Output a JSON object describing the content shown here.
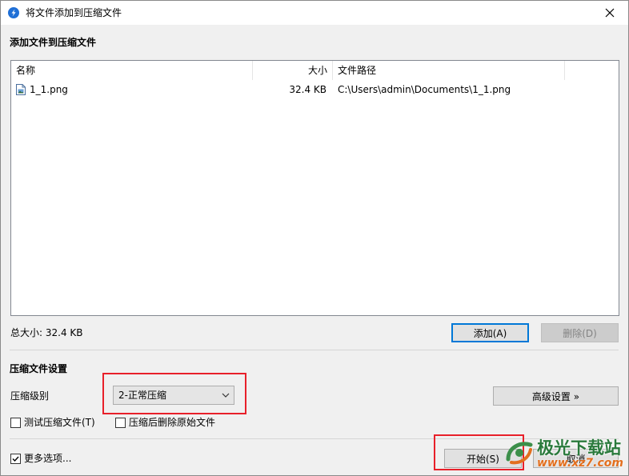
{
  "window": {
    "title": "将文件添加到压缩文件",
    "close_icon": "close-icon"
  },
  "files_section": {
    "heading": "添加文件到压缩文件",
    "columns": [
      "名称",
      "大小",
      "文件路径"
    ],
    "rows": [
      {
        "name": "1_1.png",
        "size": "32.4 KB",
        "path": "C:\\Users\\admin\\Documents\\1_1.png",
        "icon": "image-file-icon"
      }
    ],
    "total_size_label": "总大小: 32.4 KB",
    "add_button": "添加(A)",
    "delete_button": "删除(D)"
  },
  "compression_section": {
    "heading": "压缩文件设置",
    "level_label": "压缩级别",
    "level_value": "2-正常压缩",
    "advanced_button": "高级设置 »",
    "test_checkbox": {
      "label": "测试压缩文件(T)",
      "checked": false
    },
    "delete_after_checkbox": {
      "label": "压缩后删除原始文件",
      "checked": false
    }
  },
  "footer": {
    "more_options": {
      "label": "更多选项...",
      "checked": true
    },
    "start_button": "开始(S)",
    "cancel_button": "取消"
  },
  "watermark": {
    "text": "极光下载站",
    "sub": "www.xz7.com"
  },
  "colors": {
    "highlight": "#e8202a",
    "accent": "#0078d7",
    "dialog_bg": "#f0f0f0"
  }
}
